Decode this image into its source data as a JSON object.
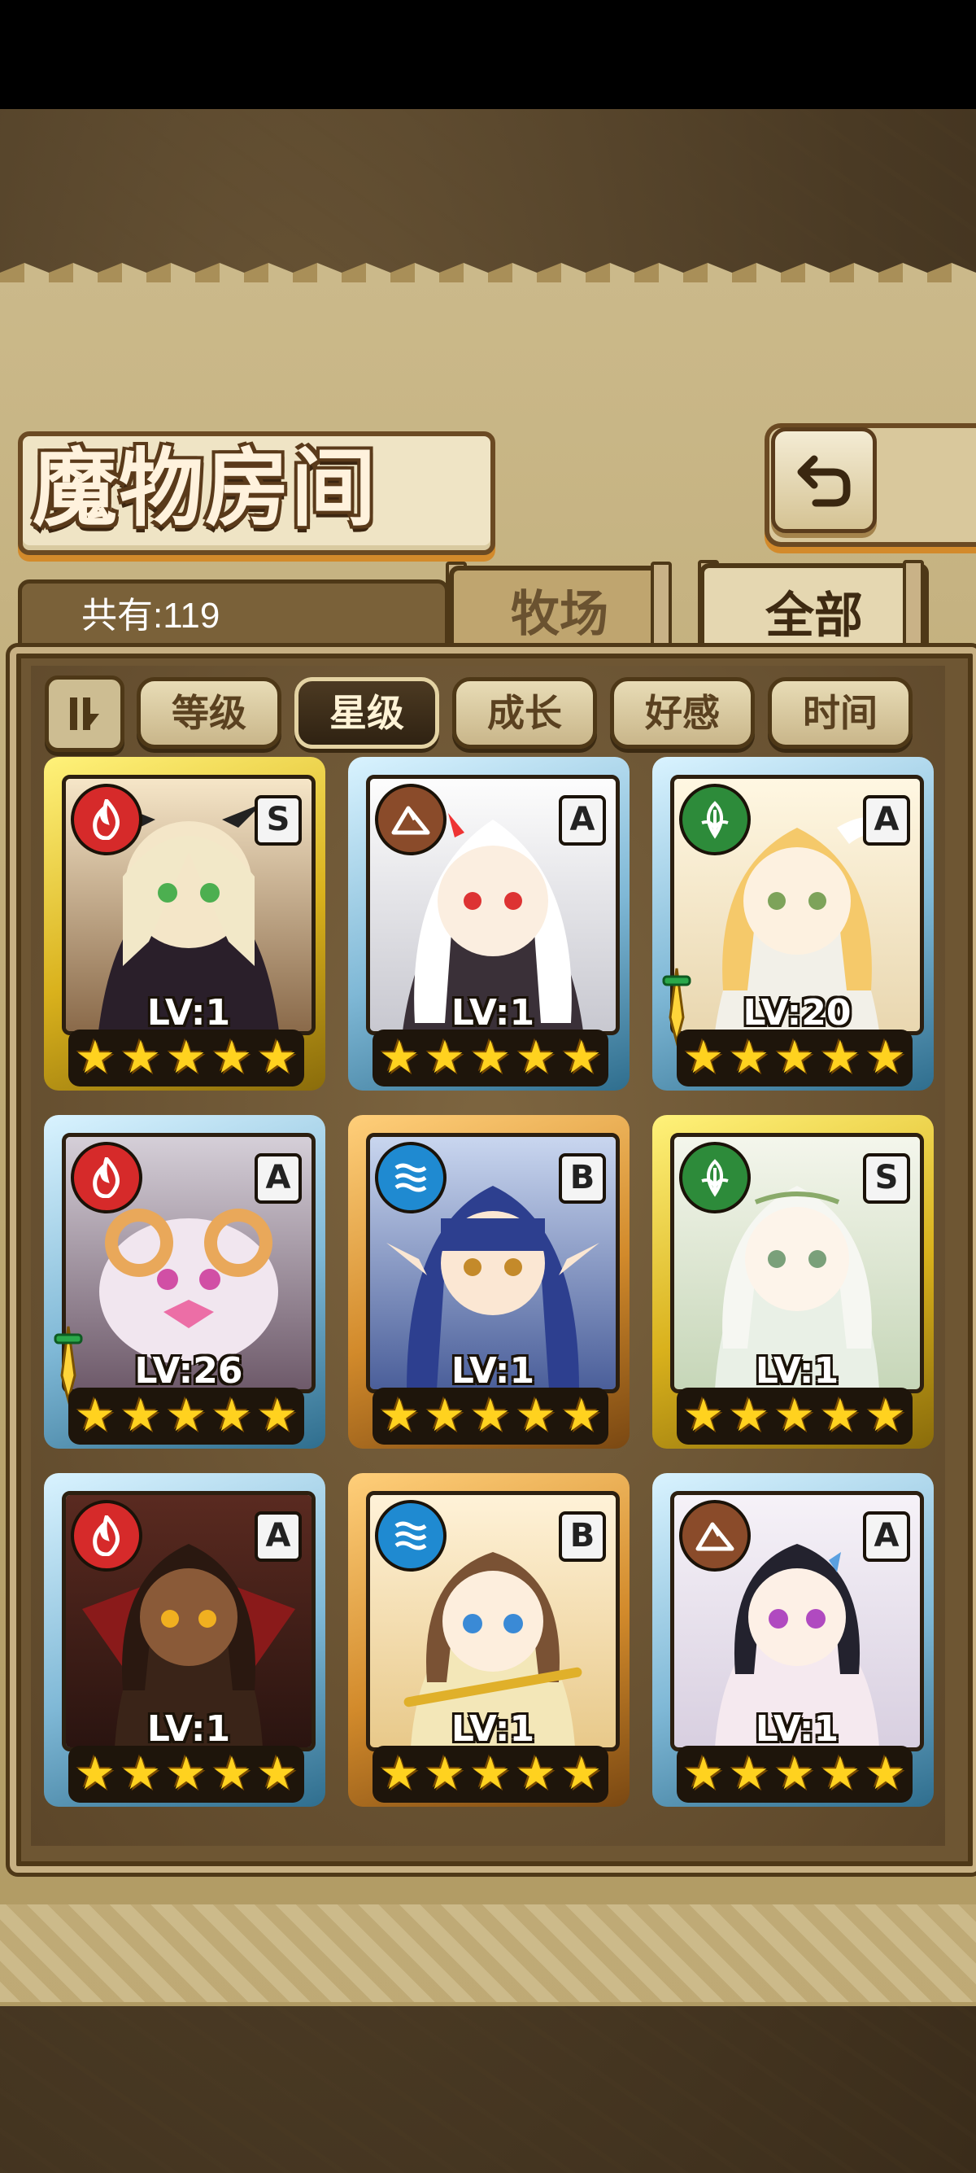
{
  "header": {
    "title": "魔物房间"
  },
  "tabs": {
    "count_label": "共有:119",
    "ranch": "牧场",
    "all": "全部"
  },
  "sort": {
    "buttons": [
      {
        "label": "等级",
        "active": false
      },
      {
        "label": "星级",
        "active": true
      },
      {
        "label": "成长",
        "active": false
      },
      {
        "label": "好感",
        "active": false
      },
      {
        "label": "时间",
        "active": false
      }
    ]
  },
  "monsters": [
    {
      "level": "LV:1",
      "rank": "S",
      "element": "fire",
      "stars": 5,
      "frame": "S"
    },
    {
      "level": "LV:1",
      "rank": "A",
      "element": "earth",
      "stars": 5,
      "frame": "A"
    },
    {
      "level": "LV:20",
      "rank": "A",
      "element": "wood",
      "stars": 5,
      "frame": "A",
      "equipped_sword": true
    },
    {
      "level": "LV:26",
      "rank": "A",
      "element": "fire",
      "stars": 5,
      "frame": "A",
      "equipped_sword": true
    },
    {
      "level": "LV:1",
      "rank": "B",
      "element": "water",
      "stars": 5,
      "frame": "B"
    },
    {
      "level": "LV:1",
      "rank": "S",
      "element": "wood",
      "stars": 5,
      "frame": "S"
    },
    {
      "level": "LV:1",
      "rank": "A",
      "element": "fire",
      "stars": 5,
      "frame": "A"
    },
    {
      "level": "LV:1",
      "rank": "B",
      "element": "water",
      "stars": 5,
      "frame": "B"
    },
    {
      "level": "LV:1",
      "rank": "A",
      "element": "earth",
      "stars": 5,
      "frame": "A"
    }
  ],
  "icons": {
    "back": "back-arrow-icon",
    "sort_toggle": "sort-order-icon",
    "fire": "flame-icon",
    "water": "water-waves-icon",
    "earth": "mountain-icon",
    "wood": "leaf-icon",
    "star": "star-icon",
    "sword": "sword-icon"
  }
}
